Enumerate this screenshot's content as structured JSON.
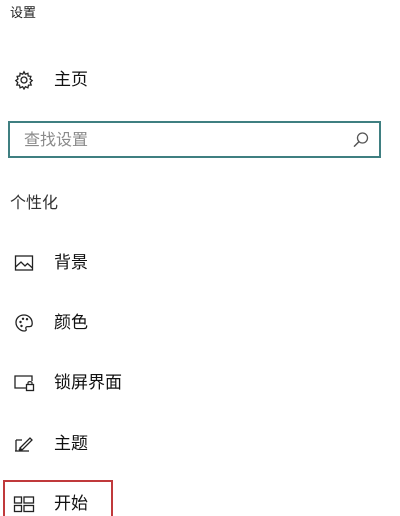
{
  "window": {
    "title": "设置"
  },
  "home": {
    "label": "主页",
    "icon": "gear-icon"
  },
  "search": {
    "placeholder": "查找设置",
    "icon": "search-icon",
    "border_color": "#3f7f81"
  },
  "section": {
    "header": "个性化"
  },
  "nav_items": [
    {
      "label": "背景",
      "icon": "picture-icon"
    },
    {
      "label": "颜色",
      "icon": "palette-icon"
    },
    {
      "label": "锁屏界面",
      "icon": "lock-screen-icon"
    },
    {
      "label": "主题",
      "icon": "theme-brush-icon"
    },
    {
      "label": "开始",
      "icon": "start-grid-icon",
      "highlighted": true,
      "highlight_color": "#c0393b"
    }
  ]
}
